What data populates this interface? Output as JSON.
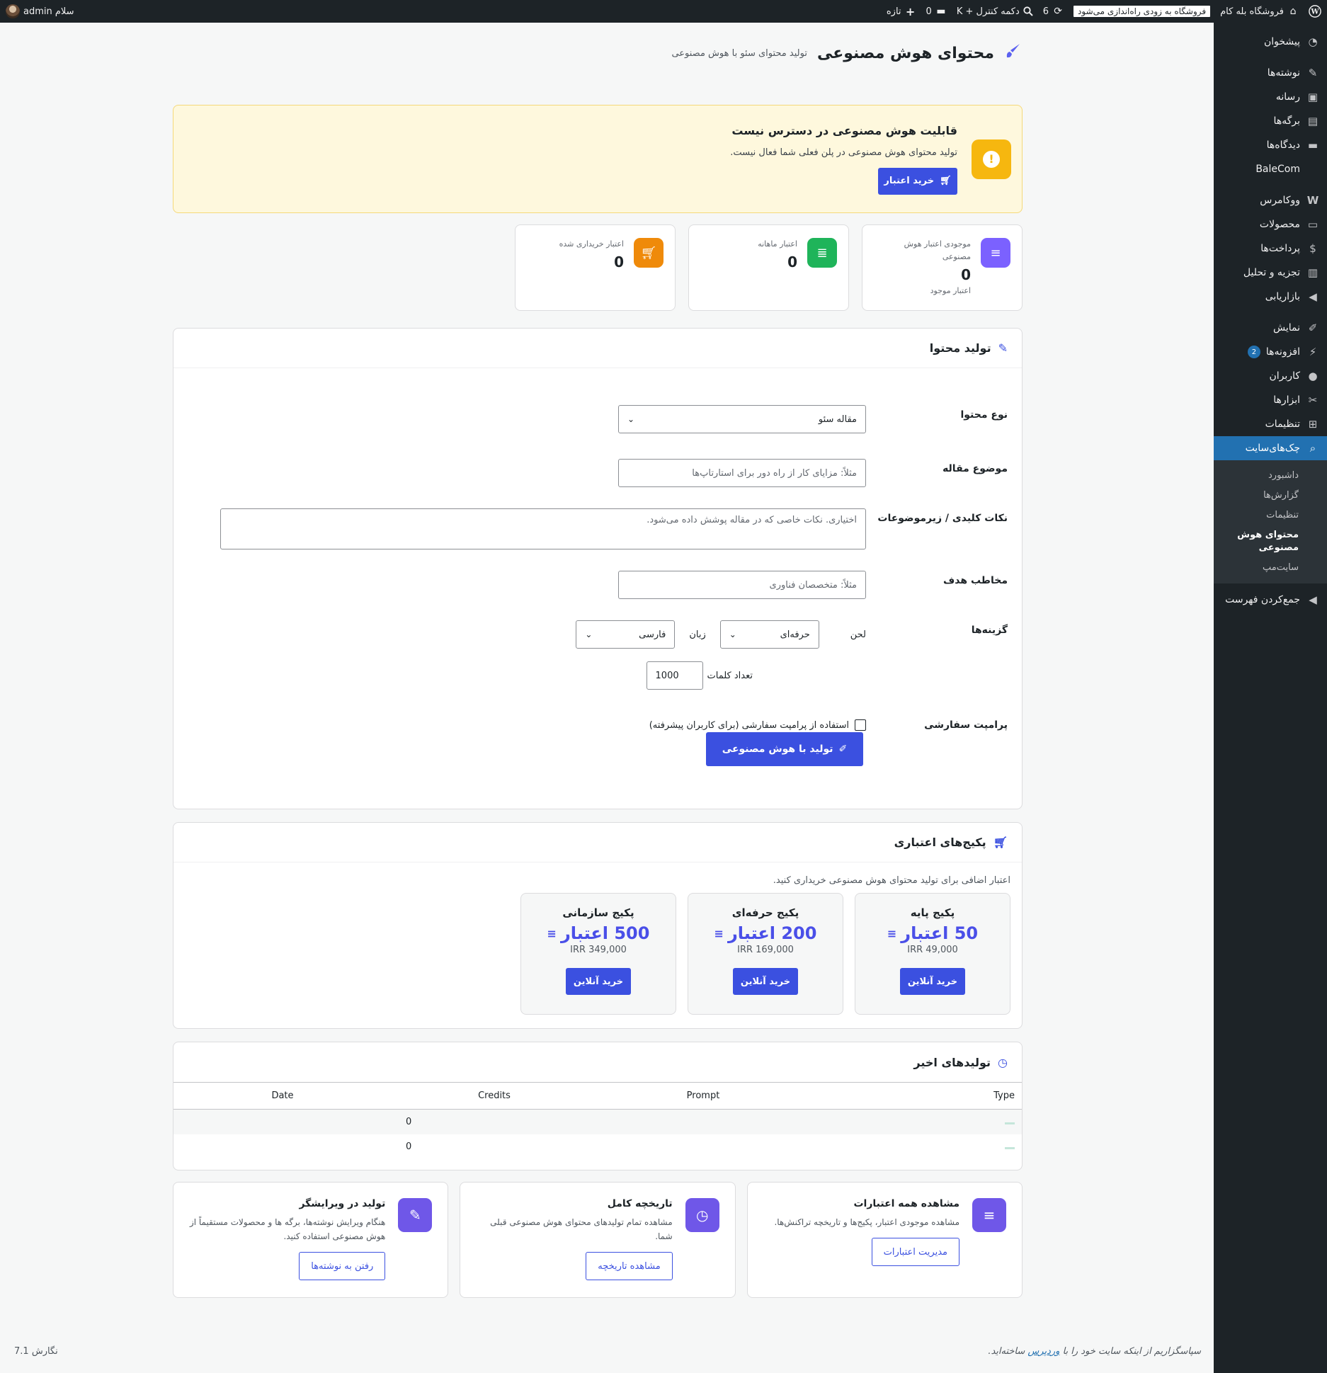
{
  "adminbar": {
    "site_name": "فروشگاه بله کام",
    "launch_notice": "فروشگاه به زودی راه‌اندازی می‌شود",
    "updates_count": "6",
    "search_shortcut": "دکمه کنترل + K",
    "comments_count": "0",
    "new_label": "تازه",
    "greeting": "سلام admin"
  },
  "sidebar": {
    "items": [
      {
        "label": "پیشخوان",
        "icon": "dashboard-icon"
      },
      {
        "label": "نوشته‌ها",
        "icon": "pin-icon"
      },
      {
        "label": "رسانه",
        "icon": "media-icon"
      },
      {
        "label": "برگه‌ها",
        "icon": "pages-icon"
      },
      {
        "label": "دیدگاه‌ها",
        "icon": "comments-icon"
      },
      {
        "label": "BaleCom",
        "icon": ""
      },
      {
        "label": "ووکامرس",
        "icon": "woo-icon"
      },
      {
        "label": "محصولات",
        "icon": "products-icon"
      },
      {
        "label": "پرداخت‌ها",
        "icon": "payments-icon"
      },
      {
        "label": "تجزیه و تحلیل",
        "icon": "analytics-icon"
      },
      {
        "label": "بازاریابی",
        "icon": "megaphone-icon"
      },
      {
        "label": "نمایش",
        "icon": "brush-icon"
      },
      {
        "label": "افزونه‌ها",
        "icon": "plugins-icon",
        "badge": "2"
      },
      {
        "label": "کاربران",
        "icon": "users-icon"
      },
      {
        "label": "ابزارها",
        "icon": "tools-icon"
      },
      {
        "label": "تنظیمات",
        "icon": "settings-icon"
      },
      {
        "label": "چک‌های‌سایت",
        "icon": "search-icon"
      },
      {
        "label": "جمع‌کردن فهرست",
        "icon": "collapse-icon"
      }
    ],
    "submenu": [
      "داشبورد",
      "گزارش‌ها",
      "تنظیمات",
      "محتوای هوش مصنوعی",
      "سایت‌مپ"
    ]
  },
  "page": {
    "title": "محتوای هوش مصنوعی",
    "subtitle": "تولید محتوای سئو با هوش مصنوعی"
  },
  "notice": {
    "title": "قابلیت هوش مصنوعی در دسترس نیست",
    "text": "تولید محتوای هوش مصنوعی در پلن فعلی شما فعال نیست.",
    "button": "خرید اعتبار"
  },
  "stats": [
    {
      "label": "موجودی اعتبار هوش مصنوعی",
      "value": "0",
      "note": "اعتبار موجود",
      "color": "#7b61ff"
    },
    {
      "label": "اعتبار ماهانه",
      "value": "0",
      "note": "",
      "color": "#1fb45a"
    },
    {
      "label": "اعتبار خریداری شده",
      "value": "0",
      "note": "",
      "color": "#ef8a0a"
    }
  ],
  "generate": {
    "title": "تولید محتوا",
    "content_type_label": "نوع محتوا",
    "content_type_value": "مقاله سئو",
    "topic_label": "موضوع مقاله",
    "topic_placeholder": "مثلاً: مزایای کار از راه دور برای استارتاپ‌ها",
    "keypoints_label": "نکات کلیدی / زیرموضوعات",
    "keypoints_placeholder": "اختیاری. نکات خاصی که در مقاله پوشش داده می‌شود.",
    "audience_label": "مخاطب هدف",
    "audience_placeholder": "مثلاً: متخصصان فناوری",
    "options_label": "گزینه‌ها",
    "tone_label": "لحن",
    "tone_value": "حرفه‌ای",
    "language_label": "زبان",
    "language_value": "فارسی",
    "wordcount_label": "تعداد کلمات",
    "wordcount_value": "1000",
    "custom_prompt_label": "پرامپت سفارشی",
    "custom_prompt_check": "استفاده از پرامپت سفارشی (برای کاربران پیشرفته)",
    "submit": "تولید با هوش مصنوعی"
  },
  "packages": {
    "title": "پکیج‌های اعتباری",
    "intro": "اعتبار اضافی برای تولید محتوای هوش مصنوعی خریداری کنید.",
    "items": [
      {
        "name": "پکیج پایه",
        "credits": "50 اعتبار",
        "price": "IRR 49,000",
        "button": "خرید آنلاین"
      },
      {
        "name": "پکیج حرفه‌ای",
        "credits": "200 اعتبار",
        "price": "IRR 169,000",
        "button": "خرید آنلاین"
      },
      {
        "name": "پکیج سازمانی",
        "credits": "500 اعتبار",
        "price": "IRR 349,000",
        "button": "خرید آنلاین"
      }
    ]
  },
  "recent": {
    "title": "تولیدهای اخیر",
    "columns": [
      "Type",
      "Prompt",
      "Credits",
      "Date"
    ],
    "rows": [
      {
        "type": "",
        "prompt": "",
        "credits": "0",
        "date": ""
      },
      {
        "type": "",
        "prompt": "",
        "credits": "0",
        "date": ""
      }
    ]
  },
  "features": [
    {
      "title": "مشاهده همه اعتبارات",
      "desc": "مشاهده موجودی اعتبار، پکیج‌ها و تاریخچه تراکنش‌ها.",
      "button": "مدیریت اعتبارات",
      "icon": "database-icon"
    },
    {
      "title": "تاریخچه کامل",
      "desc": "مشاهده تمام تولیدهای محتوای هوش مصنوعی قبلی شما.",
      "button": "مشاهده تاریخچه",
      "icon": "clock-icon"
    },
    {
      "title": "تولید در ویرایشگر",
      "desc": "هنگام ویرایش نوشته‌ها، برگه ها و محصولات مستقیماً از هوش مصنوعی استفاده کنید.",
      "button": "رفتن به نوشته‌ها",
      "icon": "pencil-icon"
    }
  ],
  "footer": {
    "thanks_before": "سپاسگزاریم از اینکه سایت خود را با",
    "thanks_link": "وردپرس",
    "thanks_after": "ساخته‌اید.",
    "version": "نگارش 7.1"
  }
}
